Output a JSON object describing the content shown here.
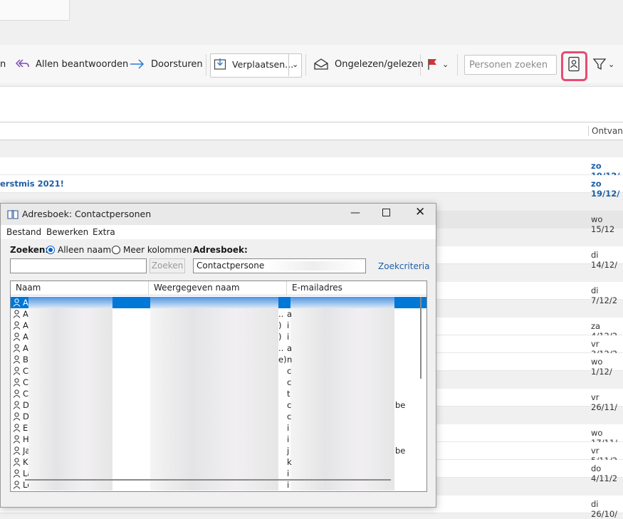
{
  "toolbar": {
    "reply_fragment": "n",
    "reply_all": "Allen beantwoorden",
    "forward": "Doorsturen",
    "move": "Verplaatsen...",
    "read_unread": "Ongelezen/gelezen",
    "search_placeholder": "Personen zoeken",
    "colors": {
      "accent": "#7d4ab8",
      "forward_arrow": "#2b7cd3",
      "flag": "#d13438",
      "highlight": "#e94b73"
    }
  },
  "list": {
    "received_header": "Ontvang",
    "rows": [
      {
        "subject": "",
        "date": "zo 19/12/",
        "blue": true
      },
      {
        "subject": "erstmis 2021!",
        "date": "zo 19/12/",
        "blue": true
      },
      {
        "subject": "",
        "date": "wo 15/12",
        "blue": false
      },
      {
        "subject": "",
        "date": "di 14/12/",
        "blue": false
      },
      {
        "subject": "",
        "date": "di 7/12/2",
        "blue": false
      },
      {
        "subject": "",
        "date": "za 4/12/2",
        "blue": false
      },
      {
        "subject": "",
        "date": "vr 3/12/2",
        "blue": false
      },
      {
        "subject": "",
        "date": "wo 1/12/",
        "blue": false
      },
      {
        "subject": "",
        "date": "vr 26/11/",
        "blue": false
      },
      {
        "subject": "",
        "date": "wo 17/11/",
        "blue": false
      },
      {
        "subject": "",
        "date": "vr 5/11/2",
        "blue": false
      },
      {
        "subject": "",
        "date": "do 4/11/2",
        "blue": false
      },
      {
        "subject": "",
        "date": "di 26/10/",
        "blue": false
      }
    ]
  },
  "dialog": {
    "title": "Adresboek: Contactpersonen",
    "menu": [
      "Bestand",
      "Bewerken",
      "Extra"
    ],
    "search_label": "Zoeken:",
    "radio_name_only": "Alleen naam",
    "radio_more_columns": "Meer kolommen",
    "addressbook_label": "Adresboek:",
    "search_button": "Zoeken",
    "addressbook_value": "Contactpersonen",
    "criteria_link": "Zoekcriteria",
    "columns": [
      "Naam",
      "Weergegeven naam",
      "E-mailadres"
    ],
    "entries": [
      {
        "initial": "A",
        "mid": "",
        "mail": ""
      },
      {
        "initial": "A",
        "mid": "..",
        "mail": "a"
      },
      {
        "initial": "A",
        "mid": ")",
        "mail": "i"
      },
      {
        "initial": "A",
        "mid": ")",
        "mail": "i"
      },
      {
        "initial": "A",
        "mid": "..",
        "mail": "a"
      },
      {
        "initial": "B",
        "mid": "e)",
        "mail": "n"
      },
      {
        "initial": "C",
        "mid": "",
        "mail": "c"
      },
      {
        "initial": "C",
        "mid": "",
        "mail": "c"
      },
      {
        "initial": "C",
        "mid": "",
        "mail": "t"
      },
      {
        "initial": "D",
        "mid": "",
        "mail": "c",
        "tail": "be"
      },
      {
        "initial": "D",
        "mid": "",
        "mail": "c"
      },
      {
        "initial": "E",
        "mid": "",
        "mail": "i"
      },
      {
        "initial": "H",
        "mid": "",
        "mail": "i"
      },
      {
        "initial": "Ja",
        "mid": "",
        "mail": "j",
        "tail": "be"
      },
      {
        "initial": "K",
        "mid": "",
        "mail": "k"
      },
      {
        "initial": "La",
        "mid": "",
        "mail": "i"
      },
      {
        "initial": "Lo",
        "mid": "",
        "mail": "i"
      }
    ]
  }
}
